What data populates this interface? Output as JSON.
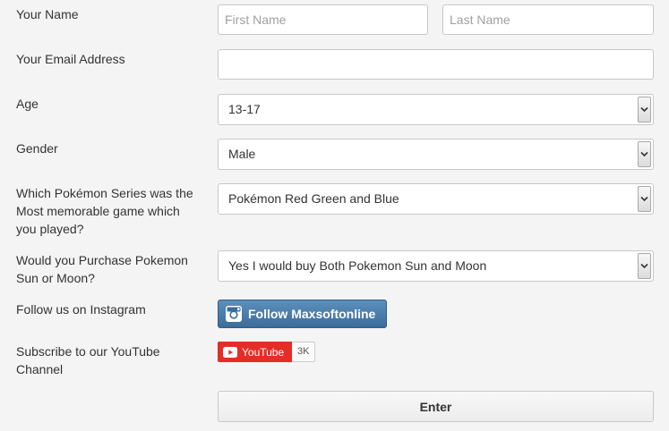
{
  "form": {
    "name": {
      "label": "Your Name",
      "first_placeholder": "First Name",
      "last_placeholder": "Last Name"
    },
    "email": {
      "label": "Your Email Address",
      "value": ""
    },
    "age": {
      "label": "Age",
      "selected": "13-17"
    },
    "gender": {
      "label": "Gender",
      "selected": "Male"
    },
    "series": {
      "label": "Which Pokémon Series was the Most memorable game which you played?",
      "selected": "Pokémon Red Green and Blue"
    },
    "purchase": {
      "label": "Would you Purchase Pokemon Sun or Moon?",
      "selected": "Yes I would buy Both Pokemon Sun and Moon"
    },
    "instagram": {
      "label": "Follow us on Instagram",
      "button_label": "Follow Maxsoftonline",
      "icon": "instagram-icon"
    },
    "youtube": {
      "label": "Subscribe to our YouTube Channel",
      "button_label": "YouTube",
      "subscriber_count": "3K",
      "icon": "youtube-icon"
    },
    "submit_label": "Enter"
  },
  "colors": {
    "instagram_button": "#3b6c9a",
    "youtube_button": "#e52d27",
    "background": "#f4f4f4"
  }
}
